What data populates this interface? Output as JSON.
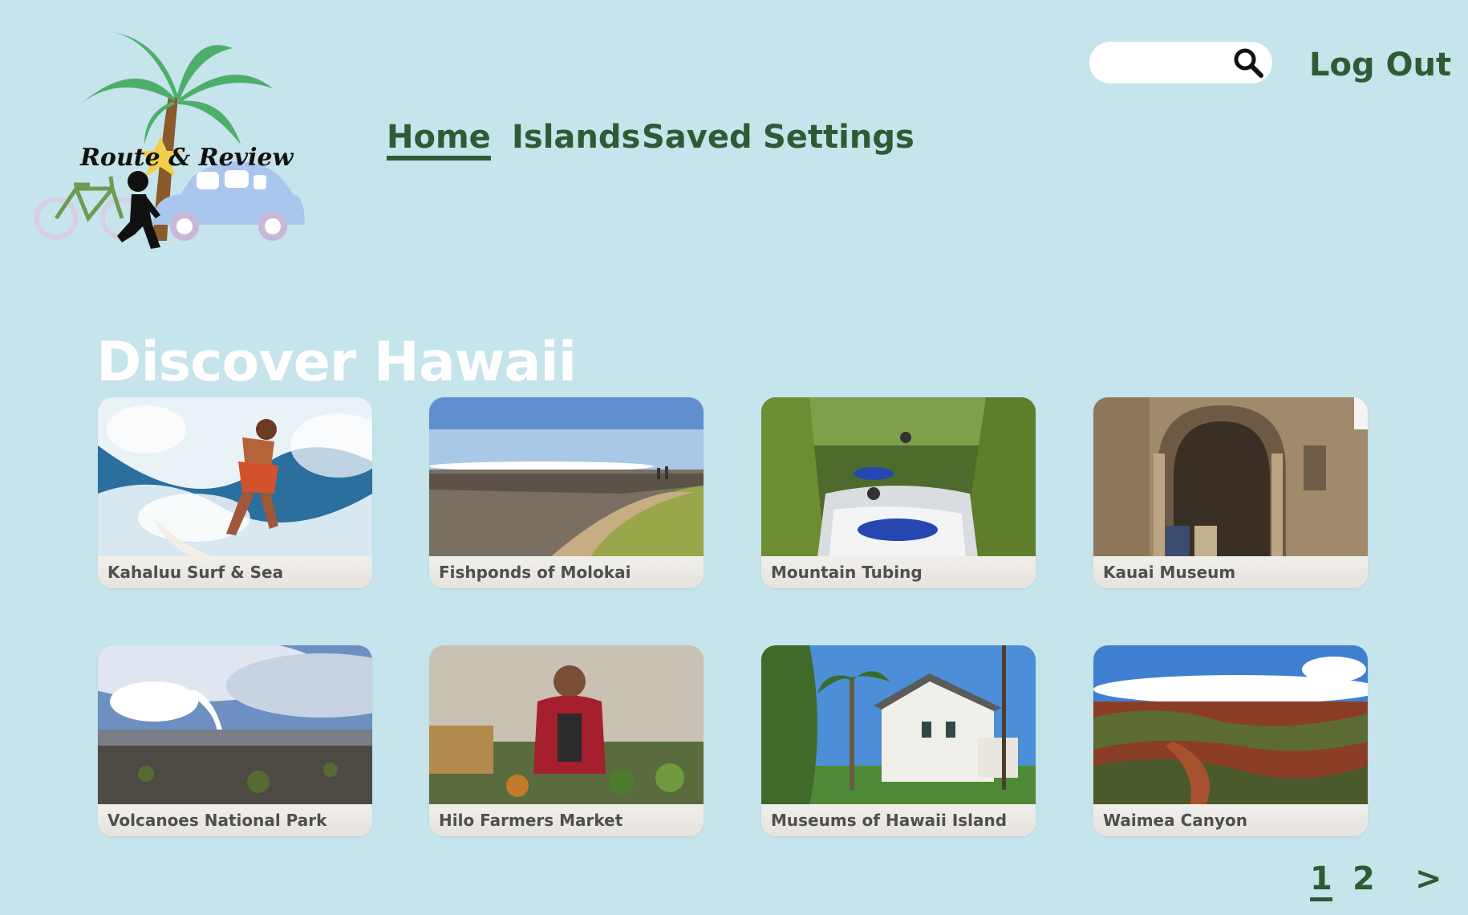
{
  "brand": {
    "logo_text": "Route & Review"
  },
  "header": {
    "search": {
      "placeholder": "",
      "value": ""
    },
    "logout_label": "Log Out"
  },
  "nav": {
    "items": [
      {
        "label": "Home",
        "active": true
      },
      {
        "label": "Islands",
        "active": false
      },
      {
        "label": "Saved",
        "active": false
      },
      {
        "label": "Settings",
        "active": false
      }
    ]
  },
  "main": {
    "title": "Discover Hawaii",
    "cards": [
      {
        "label": "Kahaluu Surf & Sea",
        "image": "surfer-in-waves"
      },
      {
        "label": "Fishponds of Molokai",
        "image": "shoreline-fishpond"
      },
      {
        "label": "Mountain Tubing",
        "image": "tubing-in-jungle-stream"
      },
      {
        "label": "Kauai Museum",
        "image": "stone-museum-archway"
      },
      {
        "label": "Volcanoes National Park",
        "image": "volcano-steam-plume"
      },
      {
        "label": "Hilo Farmers Market",
        "image": "market-vendor"
      },
      {
        "label": "Museums of Hawaii Island",
        "image": "white-house-palms"
      },
      {
        "label": "Waimea Canyon",
        "image": "red-canyon"
      }
    ]
  },
  "pagination": {
    "pages": [
      "1",
      "2"
    ],
    "current": "1",
    "next_label": ">"
  },
  "colors": {
    "background": "#c5e4ec",
    "accent": "#2f5a36",
    "title": "#ffffff"
  }
}
